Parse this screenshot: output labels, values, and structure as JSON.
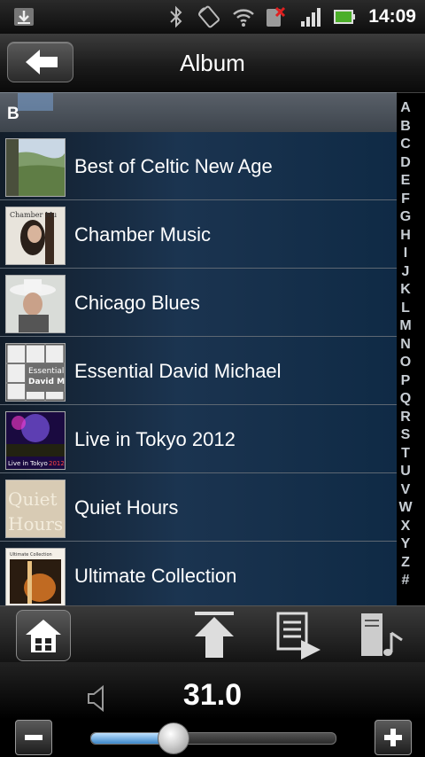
{
  "status_bar": {
    "time": "14:09",
    "icons": [
      "download-icon",
      "bluetooth-icon",
      "rotation-icon",
      "wifi-icon",
      "no-sim-icon",
      "signal-icon",
      "battery-icon"
    ]
  },
  "header": {
    "title": "Album",
    "back_icon": "back-arrow-icon"
  },
  "section": {
    "letter": "B"
  },
  "albums": [
    {
      "title": "Best of Celtic New Age"
    },
    {
      "title": "Chamber Music",
      "cover_text": "Chamber Mu"
    },
    {
      "title": "Chicago Blues"
    },
    {
      "title": "Essential David Michael",
      "cover_text_1": "Essential",
      "cover_text_2": "David Michael"
    },
    {
      "title": "Live in Tokyo 2012",
      "cover_text_1": "Live in Tokyo",
      "cover_text_2": "2012"
    },
    {
      "title": "Quiet Hours",
      "cover_text_1": "Quiet",
      "cover_text_2": "Hours"
    },
    {
      "title": "Ultimate Collection",
      "cover_text": "Ultimate Collection"
    }
  ],
  "alphabet": [
    "A",
    "B",
    "C",
    "D",
    "E",
    "F",
    "G",
    "H",
    "I",
    "J",
    "K",
    "L",
    "M",
    "N",
    "O",
    "P",
    "Q",
    "R",
    "S",
    "T",
    "U",
    "V",
    "W",
    "X",
    "Y",
    "Z",
    "#"
  ],
  "toolbar": {
    "icons": [
      "home-icon",
      "scroll-to-top-icon",
      "playlist-icon",
      "media-server-icon"
    ]
  },
  "volume": {
    "value": "31.0",
    "level": 0.31,
    "minus_icon": "minus-icon",
    "plus_icon": "plus-icon",
    "speaker_icon": "speaker-icon"
  }
}
